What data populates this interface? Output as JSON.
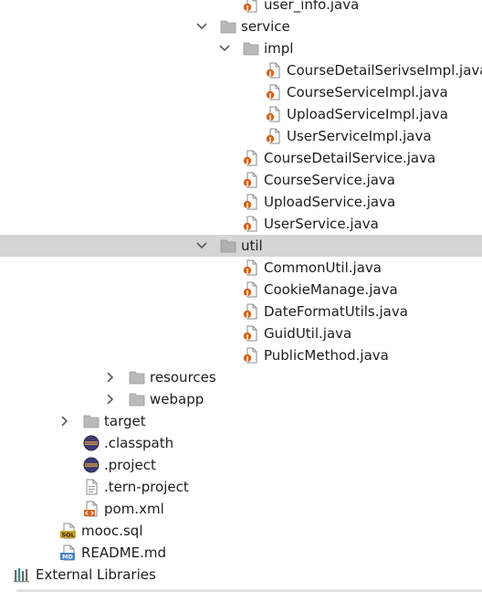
{
  "tree": {
    "items": [
      {
        "label": "user_info.java",
        "icon": "java-file-icon"
      },
      {
        "label": "service",
        "icon": "folder-icon",
        "arrow": "chevron-down-icon"
      },
      {
        "label": "impl",
        "icon": "folder-icon",
        "arrow": "chevron-down-icon"
      },
      {
        "label": "CourseDetailSerivseImpl.java",
        "icon": "java-file-icon"
      },
      {
        "label": "CourseServiceImpl.java",
        "icon": "java-file-icon"
      },
      {
        "label": "UploadServiceImpl.java",
        "icon": "java-file-icon"
      },
      {
        "label": "UserServiceImpl.java",
        "icon": "java-file-icon"
      },
      {
        "label": "CourseDetailService.java",
        "icon": "java-file-icon"
      },
      {
        "label": "CourseService.java",
        "icon": "java-file-icon"
      },
      {
        "label": "UploadService.java",
        "icon": "java-file-icon"
      },
      {
        "label": "UserService.java",
        "icon": "java-file-icon"
      },
      {
        "label": "util",
        "icon": "folder-icon",
        "arrow": "chevron-down-icon",
        "selected": true
      },
      {
        "label": "CommonUtil.java",
        "icon": "java-file-icon"
      },
      {
        "label": "CookieManage.java",
        "icon": "java-file-icon"
      },
      {
        "label": "DateFormatUtils.java",
        "icon": "java-file-icon"
      },
      {
        "label": "GuidUtil.java",
        "icon": "java-file-icon"
      },
      {
        "label": "PublicMethod.java",
        "icon": "java-file-icon"
      },
      {
        "label": "resources",
        "icon": "folder-icon",
        "arrow": "chevron-right-icon"
      },
      {
        "label": "webapp",
        "icon": "folder-icon",
        "arrow": "chevron-right-icon"
      },
      {
        "label": "target",
        "icon": "folder-icon",
        "arrow": "chevron-right-icon"
      },
      {
        "label": ".classpath",
        "icon": "eclipse-file-icon"
      },
      {
        "label": ".project",
        "icon": "eclipse-file-icon"
      },
      {
        "label": ".tern-project",
        "icon": "text-file-icon"
      },
      {
        "label": "pom.xml",
        "icon": "xml-file-icon"
      },
      {
        "label": "mooc.sql",
        "icon": "sql-file-icon"
      },
      {
        "label": "README.md",
        "icon": "markdown-file-icon"
      },
      {
        "label": "External Libraries",
        "icon": "libraries-icon"
      }
    ]
  },
  "colors": {
    "selection": "#d5d5d5",
    "folder": "#b9b9b9",
    "java_accent": "#d4631a",
    "eclipse": "#3b3a73",
    "sql": "#c9a227",
    "markdown": "#4a82c4"
  }
}
